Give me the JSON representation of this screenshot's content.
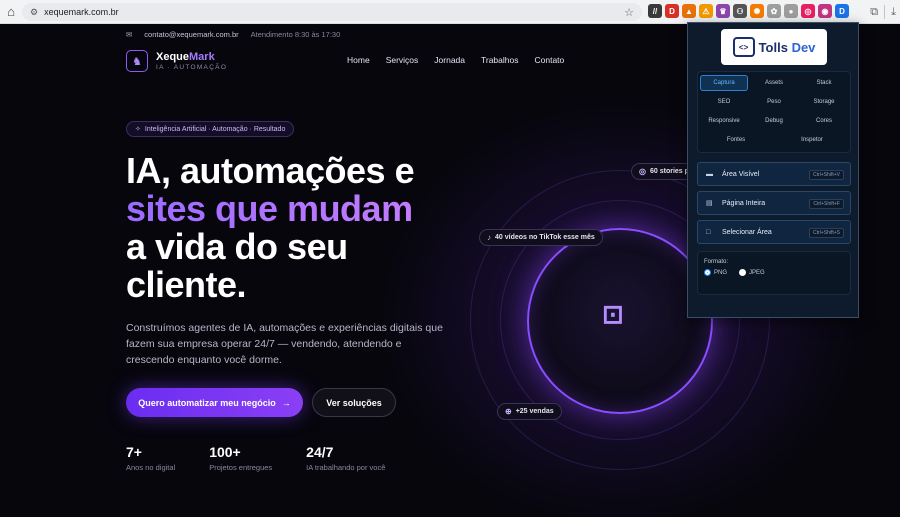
{
  "browser": {
    "url": "xequemark.com.br",
    "extensions": [
      {
        "icon": "tolls-icon",
        "color": "#3a3a3a",
        "glyph": "//"
      },
      {
        "icon": "shield-red-icon",
        "color": "#d93025",
        "glyph": "D"
      },
      {
        "icon": "fox-icon",
        "color": "#e8710a",
        "glyph": "▲"
      },
      {
        "icon": "alert-icon",
        "color": "#f29900",
        "glyph": "⚠"
      },
      {
        "icon": "cat-icon",
        "color": "#8e44ad",
        "glyph": "♛"
      },
      {
        "icon": "link-icon",
        "color": "#555555",
        "glyph": "⚇"
      },
      {
        "icon": "sun-icon",
        "color": "#f57c00",
        "glyph": "✺"
      },
      {
        "icon": "leaf-icon",
        "color": "#9e9e9e",
        "glyph": "✿"
      },
      {
        "icon": "ball-icon",
        "color": "#9e9e9e",
        "glyph": "●"
      },
      {
        "icon": "target-icon",
        "color": "#e91e63",
        "glyph": "◎"
      },
      {
        "icon": "instagram-icon",
        "color": "#c13584",
        "glyph": "◉"
      },
      {
        "icon": "tolls-active-icon",
        "color": "#1a73e8",
        "glyph": "D"
      }
    ]
  },
  "site": {
    "contact_email": "contato@xequemark.com.br",
    "hours": "Atendimento 8:30 às 17:30",
    "brand_a": "Xeque",
    "brand_b": "Mark",
    "brand_sub": "IA · AUTOMAÇÃO",
    "menu": [
      "Home",
      "Serviços",
      "Jornada",
      "Trabalhos",
      "Contato"
    ],
    "pill": "Inteligência Artificial · Automação · Resultado",
    "hero_line1": "IA, automações e",
    "hero_line2": "sites que mudam",
    "hero_line3": "a vida do seu",
    "hero_line4": "cliente.",
    "lead": "Construímos agentes de IA, automações e experiências digitais que fazem sua empresa operar 24/7 — vendendo, atendendo e crescendo enquanto você dorme.",
    "cta_primary": "Quero automatizar meu negócio",
    "cta_secondary": "Ver soluções",
    "stats": [
      {
        "value": "7+",
        "label": "Anos no digital"
      },
      {
        "value": "100+",
        "label": "Projetos entregues"
      },
      {
        "value": "24/7",
        "label": "IA trabalhando por você"
      }
    ],
    "chips": {
      "stories": "60 stories p",
      "tiktok": "40 vídeos no TikTok esse mês",
      "sales": "+25 vendas"
    }
  },
  "popup": {
    "brand_a": "Tolls",
    "brand_b": "Dev",
    "tabs": [
      "Captura",
      "Assets",
      "Stack",
      "SEO",
      "Peso",
      "Storage",
      "Responsive",
      "Debug",
      "Cores",
      "Fontes",
      "Inspetor"
    ],
    "actions": [
      {
        "label": "Área Visível",
        "shortcut": "Ctrl+Shift+V"
      },
      {
        "label": "Página Inteira",
        "shortcut": "Ctrl+Shift+F"
      },
      {
        "label": "Selecionar Área",
        "shortcut": "Ctrl+Shift+S"
      }
    ],
    "format_label": "Formato:",
    "format_options": [
      "PNG",
      "JPEG"
    ],
    "format_selected": "PNG"
  }
}
